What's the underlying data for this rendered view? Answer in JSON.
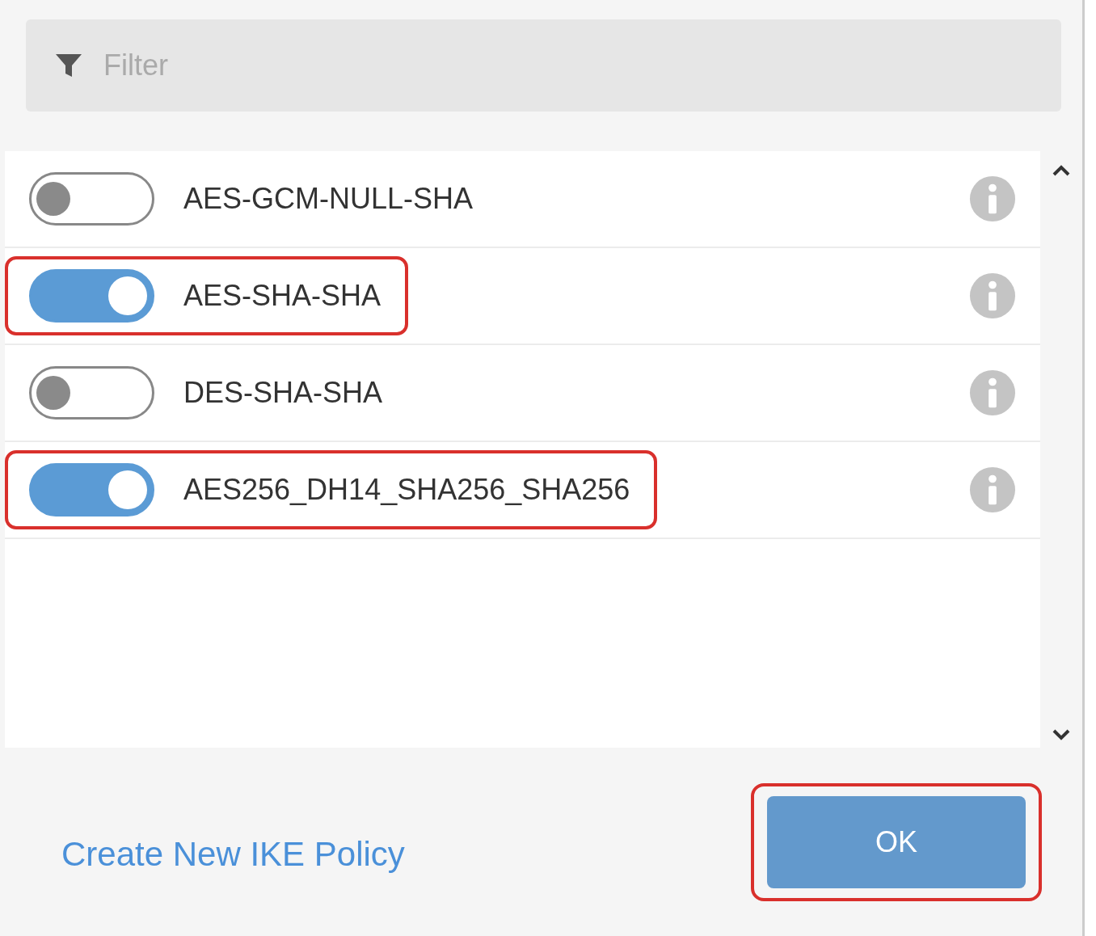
{
  "filter": {
    "placeholder": "Filter"
  },
  "items": [
    {
      "label": "AES-GCM-NULL-SHA",
      "on": false,
      "highlighted": false
    },
    {
      "label": "AES-SHA-SHA",
      "on": true,
      "highlighted": true
    },
    {
      "label": "DES-SHA-SHA",
      "on": false,
      "highlighted": false
    },
    {
      "label": "AES256_DH14_SHA256_SHA256",
      "on": true,
      "highlighted": true
    }
  ],
  "footer": {
    "link": "Create New IKE Policy",
    "ok_button": {
      "label": "OK",
      "highlighted": true
    }
  }
}
